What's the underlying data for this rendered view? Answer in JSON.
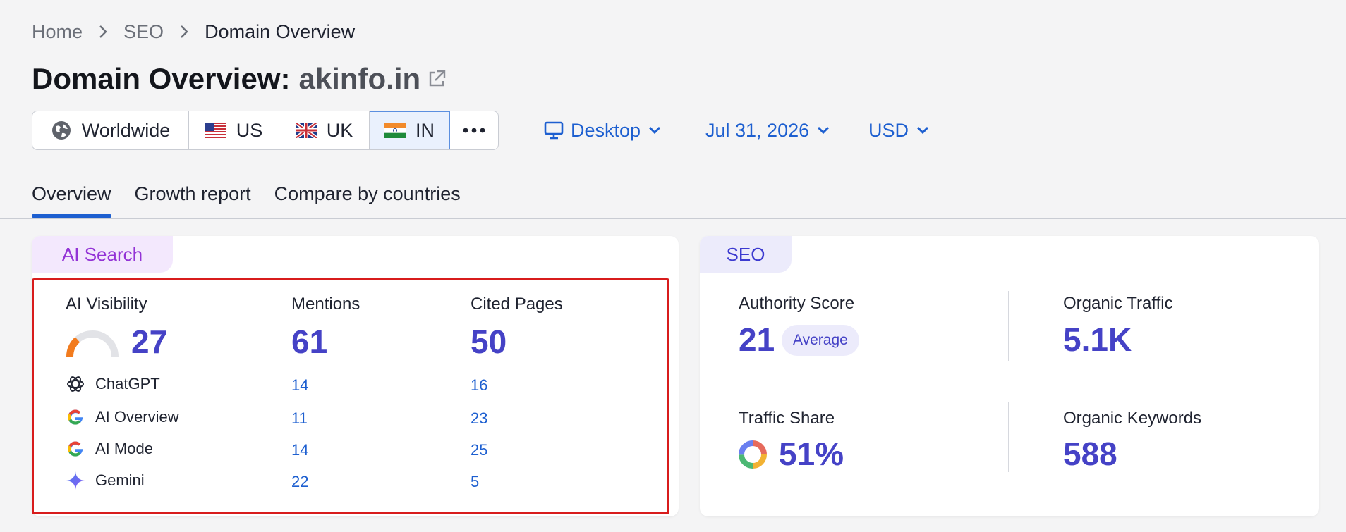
{
  "breadcrumb": {
    "items": [
      "Home",
      "SEO",
      "Domain Overview"
    ]
  },
  "page": {
    "title_prefix": "Domain Overview:",
    "domain": "akinfo.in"
  },
  "regions": [
    {
      "label": "Worldwide",
      "icon": "globe-icon",
      "active": false
    },
    {
      "label": "US",
      "icon": "us-flag-icon",
      "active": false
    },
    {
      "label": "UK",
      "icon": "uk-flag-icon",
      "active": false
    },
    {
      "label": "IN",
      "icon": "india-flag-icon",
      "active": true
    },
    {
      "label": "",
      "icon": "more-dots-icon",
      "active": false
    }
  ],
  "filters": {
    "device": "Desktop",
    "date": "Jul 31, 2026",
    "currency": "USD"
  },
  "tabs": [
    {
      "label": "Overview",
      "active": true
    },
    {
      "label": "Growth report",
      "active": false
    },
    {
      "label": "Compare by countries",
      "active": false
    }
  ],
  "ai_search": {
    "label": "AI Search",
    "columns": {
      "visibility": "AI Visibility",
      "mentions": "Mentions",
      "cited": "Cited Pages"
    },
    "totals": {
      "visibility": "27",
      "visibility_fraction": 0.27,
      "mentions": "61",
      "cited": "50"
    },
    "rows": [
      {
        "name": "ChatGPT",
        "icon": "chatgpt-icon",
        "mentions": "14",
        "cited": "16"
      },
      {
        "name": "AI Overview",
        "icon": "google-icon",
        "mentions": "11",
        "cited": "23"
      },
      {
        "name": "AI Mode",
        "icon": "google-icon",
        "mentions": "14",
        "cited": "25"
      },
      {
        "name": "Gemini",
        "icon": "gemini-icon",
        "mentions": "22",
        "cited": "5"
      }
    ]
  },
  "seo": {
    "label": "SEO",
    "authority_score": {
      "label": "Authority Score",
      "value": "21",
      "badge": "Average"
    },
    "organic_traffic": {
      "label": "Organic Traffic",
      "value": "5.1K"
    },
    "traffic_share": {
      "label": "Traffic Share",
      "value": "51%"
    },
    "organic_keywords": {
      "label": "Organic Keywords",
      "value": "588"
    }
  },
  "colors": {
    "accent": "#1d5fd0",
    "metric": "#4542c6",
    "ai_label": "#9333d6",
    "highlight": "#d81c1c"
  }
}
